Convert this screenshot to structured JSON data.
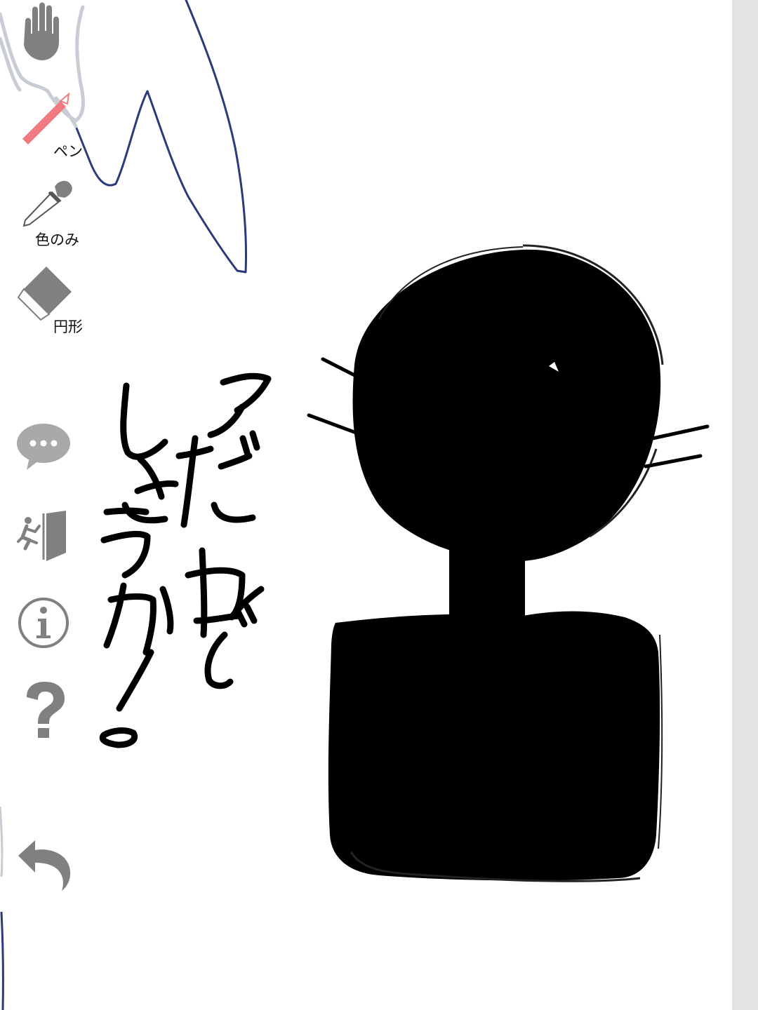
{
  "toolbar": {
    "pan_tool": {
      "icon": "hand-icon"
    },
    "pen_tool": {
      "label": "ペン",
      "icon": "pencil-icon",
      "color": "#f07a80"
    },
    "picker_tool": {
      "label": "色のみ",
      "icon": "eyedropper-icon"
    },
    "eraser_tool": {
      "label": "円形",
      "icon": "eraser-icon"
    }
  },
  "actions": {
    "chat": {
      "icon": "chat-bubble-icon"
    },
    "exit": {
      "icon": "exit-door-icon"
    },
    "info": {
      "icon": "info-icon"
    },
    "help": {
      "icon": "question-mark-icon"
    },
    "undo": {
      "icon": "undo-icon"
    }
  },
  "canvas": {
    "handwritten_text": "アだれでしょうか!。",
    "ink_color": "#000000",
    "stroke_color": "#2a3a7a",
    "background": "#ffffff"
  },
  "colors": {
    "icon_gray": "#808080",
    "scrollbar": "#e3e3e1"
  }
}
